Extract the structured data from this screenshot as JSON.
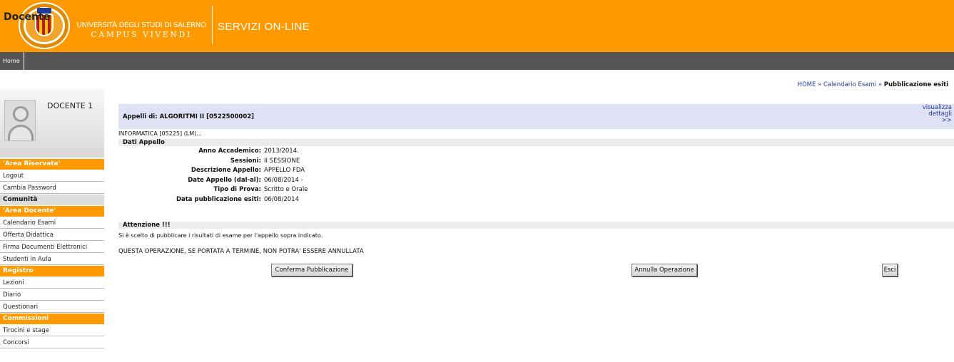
{
  "header": {
    "university": "UNIVERSITÀ DEGLI STUDI DI SALERNO",
    "motto": "CAMPUS VIVENDI",
    "section": "SERVIZI ON-LINE"
  },
  "topnav": {
    "home": "Home"
  },
  "sidebar": {
    "title": "Docente",
    "user_name": "DOCENTE 1",
    "menu": [
      {
        "type": "header",
        "label": "'Area Riservata'"
      },
      {
        "type": "item",
        "label": "Logout"
      },
      {
        "type": "item",
        "label": "Cambia Password"
      },
      {
        "type": "header-gray",
        "label": "Comunità"
      },
      {
        "type": "header",
        "label": "'Area Docente'"
      },
      {
        "type": "item",
        "label": "Calendario Esami"
      },
      {
        "type": "item",
        "label": "Offerta Didattica"
      },
      {
        "type": "item",
        "label": "Firma Documenti Elettronici"
      },
      {
        "type": "item",
        "label": "Studenti in Aula"
      },
      {
        "type": "header",
        "label": "Registro"
      },
      {
        "type": "item",
        "label": "Lezioni"
      },
      {
        "type": "item",
        "label": "Diario"
      },
      {
        "type": "item",
        "label": "Questionari"
      },
      {
        "type": "header",
        "label": "Commissioni"
      },
      {
        "type": "item",
        "label": "Tirocini e stage"
      },
      {
        "type": "item",
        "label": "Concorsi"
      }
    ]
  },
  "breadcrumb": {
    "home": "HOME",
    "sep1": "»",
    "calendario": "Calendario Esami",
    "sep2": "»",
    "current": "Pubblicazione esiti"
  },
  "appello": {
    "title": "Appelli di: ALGORITMI II [0522500002]",
    "details_link": [
      "visualizza",
      "dettagli",
      ">>"
    ],
    "corso": "INFORMATICA [05225] (LM)..."
  },
  "dati_appello": {
    "heading": "Dati Appello",
    "fields": [
      {
        "label": "Anno Accademico:",
        "value": "2013/2014."
      },
      {
        "label": "Sessioni:",
        "value": "II SESSIONE"
      },
      {
        "label": "Descrizione Appello:",
        "value": "APPELLO FDA"
      },
      {
        "label": "Date Appello (dal-al):",
        "value": "06/08/2014 -"
      },
      {
        "label": "Tipo di Prova:",
        "value": "Scritto e Orale"
      },
      {
        "label": "Data pubblicazione esiti:",
        "value": "06/08/2014"
      }
    ]
  },
  "attenzione": {
    "heading": "Attenzione !!!",
    "message": "Si è scelto di pubblicare i risultati di esame per l'appello sopra indicato.",
    "warning": "QUESTA OPERAZIONE, SE PORTATA A TERMINE, NON POTRA' ESSERE ANNULLATA"
  },
  "buttons": {
    "confirm": "Conferma Pubblicazione",
    "cancel": "Annulla Operazione",
    "exit": "Esci"
  },
  "colors": {
    "accent": "#ff9900",
    "nav": "#555555",
    "bar": "#dfe1f5",
    "link": "#1d3c9a"
  }
}
